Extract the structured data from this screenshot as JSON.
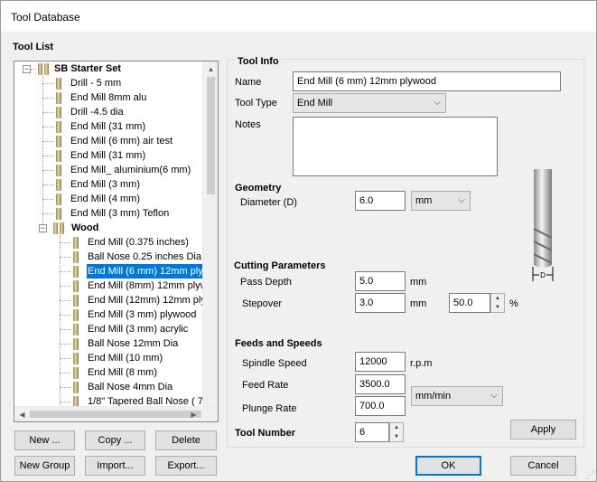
{
  "window": {
    "title": "Tool Database"
  },
  "tool_list": {
    "label": "Tool List",
    "groups": [
      {
        "name": "SB Starter Set"
      },
      {
        "name": "Wood"
      }
    ],
    "root_items": [
      "Drill - 5 mm",
      "End Mill 8mm alu",
      "Drill -4.5 dia",
      "End Mill (31 mm)",
      "End Mill (6 mm) air test",
      "End Mill (31 mm)",
      "End Mill_ aluminium(6 mm)",
      "End Mill (3 mm)",
      "End Mill (4 mm)",
      "End Mill (3 mm) Teflon"
    ],
    "wood_items": [
      "End Mill (0.375 inches)",
      "Ball Nose 0.25 inches Dia",
      "End Mill (6 mm) 12mm plyw",
      "End Mill (8mm) 12mm plywo",
      "End Mill (12mm) 12mm plyw",
      "End Mill (3 mm) plywood",
      "End Mill (3 mm) acrylic",
      "Ball Nose 12mm Dia",
      "End Mill (10 mm)",
      "End Mill (8 mm)",
      "Ball Nose 4mm Dia",
      "1/8\" Tapered Ball Nose ( 7"
    ],
    "selected_item": "End Mill (6 mm) 12mm plyw"
  },
  "buttons": {
    "new": "New ...",
    "copy": "Copy ...",
    "delete": "Delete",
    "new_group": "New Group",
    "import": "Import...",
    "export": "Export...",
    "apply": "Apply",
    "ok": "OK",
    "cancel": "Cancel"
  },
  "tool_info": {
    "label": "Tool Info",
    "name_label": "Name",
    "name_value": "End Mill (6 mm) 12mm plywood",
    "type_label": "Tool Type",
    "type_value": "End Mill",
    "notes_label": "Notes",
    "notes_value": ""
  },
  "geometry": {
    "label": "Geometry",
    "diameter_label": "Diameter (D)",
    "diameter_value": "6.0",
    "unit_value": "mm",
    "diagram_label": "D"
  },
  "cutting": {
    "label": "Cutting Parameters",
    "pass_depth_label": "Pass Depth",
    "pass_depth_value": "5.0",
    "pass_depth_unit": "mm",
    "stepover_label": "Stepover",
    "stepover_value": "3.0",
    "stepover_unit": "mm",
    "stepover_pct_value": "50.0",
    "pct_sign": "%"
  },
  "feeds": {
    "label": "Feeds and Speeds",
    "spindle_label": "Spindle Speed",
    "spindle_value": "12000",
    "spindle_unit": "r.p.m",
    "feed_label": "Feed Rate",
    "feed_value": "3500.0",
    "plunge_label": "Plunge Rate",
    "plunge_value": "700.0",
    "rate_unit": "mm/min"
  },
  "tool_number": {
    "label": "Tool Number",
    "value": "6"
  }
}
